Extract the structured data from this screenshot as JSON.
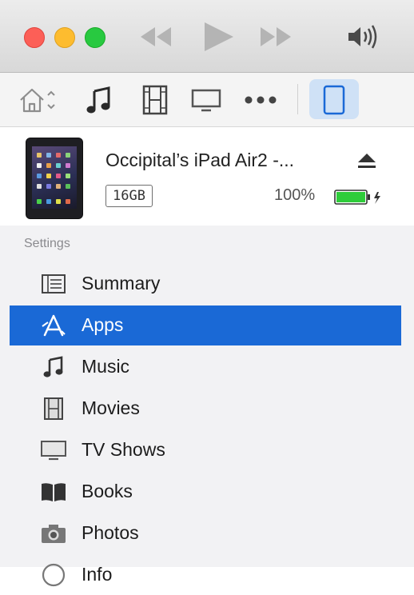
{
  "window": {
    "traffic_lights": [
      "close",
      "minimize",
      "zoom"
    ],
    "controls": [
      "rewind-icon",
      "play-icon",
      "fast-forward-icon",
      "volume-icon"
    ]
  },
  "toolbar": {
    "items": [
      "home-icon",
      "music-note-icon",
      "film-icon",
      "tv-icon",
      "more-icon",
      "ipad-icon"
    ],
    "selected": "ipad-icon"
  },
  "device": {
    "name": "Occipital’s iPad Air2 -...",
    "capacity": "16GB",
    "battery_percent": "100%",
    "battery_level": 1.0,
    "charging": true
  },
  "sidebar": {
    "section_title": "Settings",
    "items": [
      {
        "label": "Summary",
        "icon": "summary-icon"
      },
      {
        "label": "Apps",
        "icon": "apps-icon",
        "selected": true
      },
      {
        "label": "Music",
        "icon": "music-note-icon"
      },
      {
        "label": "Movies",
        "icon": "film-icon"
      },
      {
        "label": "TV Shows",
        "icon": "tv-icon"
      },
      {
        "label": "Books",
        "icon": "books-icon"
      },
      {
        "label": "Photos",
        "icon": "camera-icon"
      },
      {
        "label": "Info",
        "icon": "info-icon"
      }
    ]
  },
  "colors": {
    "selection": "#1a69d6",
    "toolbar_selected": "#cfe1f6",
    "battery": "#2ecc3a",
    "close": "#fc5f57",
    "minimize": "#fdbc2f",
    "zoom": "#28c940"
  }
}
